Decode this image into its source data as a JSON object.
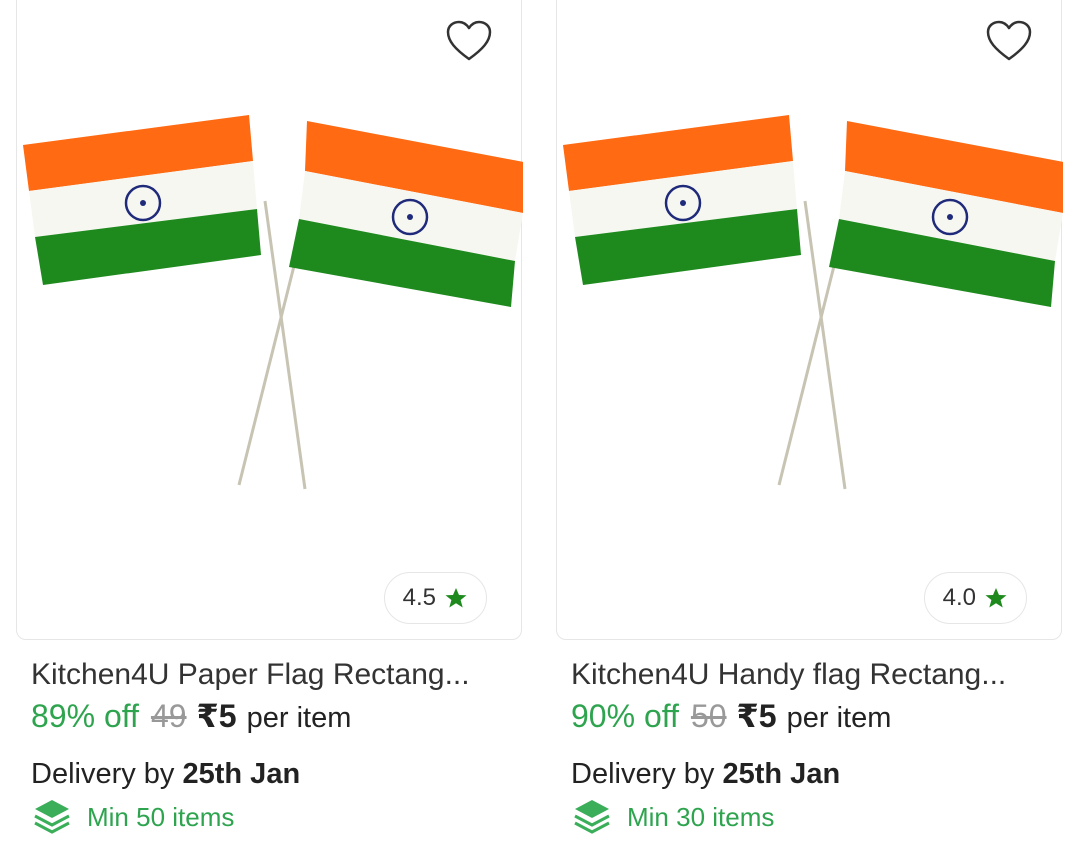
{
  "products": [
    {
      "rating": "4.5",
      "title": "Kitchen4U Paper Flag Rectang...",
      "discount": "89% off",
      "mrp": "49",
      "price": "₹5",
      "unit": "per item",
      "delivery_prefix": "Delivery by",
      "delivery_date": "25th Jan",
      "min_qty": "Min 50 items"
    },
    {
      "rating": "4.0",
      "title": "Kitchen4U Handy flag Rectang...",
      "discount": "90% off",
      "mrp": "50",
      "price": "₹5",
      "unit": "per item",
      "delivery_prefix": "Delivery by",
      "delivery_date": "25th Jan",
      "min_qty": "Min 30 items"
    }
  ],
  "icons": {
    "wishlist": "heart-icon",
    "rating": "star-icon",
    "min_qty": "layers-icon"
  },
  "colors": {
    "saffron": "#FF6A13",
    "green": "#1E8A1E",
    "chakra": "#1F2A7A",
    "discount": "#2EA44F"
  }
}
